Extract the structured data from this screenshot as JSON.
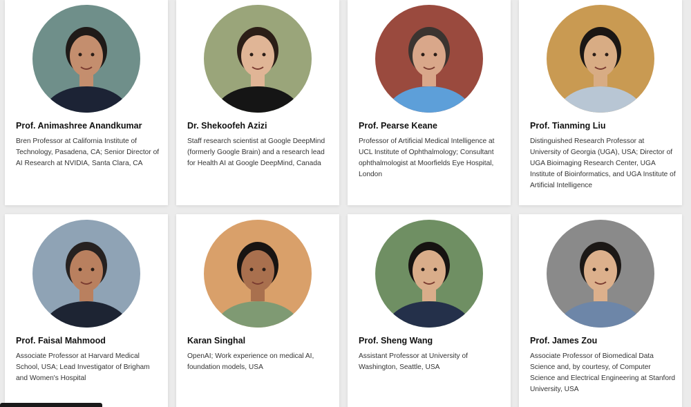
{
  "people": [
    {
      "name": "Prof. Animashree Anandkumar",
      "description": "Bren Professor at California Institute of Technology, Pasadena, CA; Senior Director of AI Research at NVIDIA, Santa Clara, CA",
      "photo": "portrait-photo",
      "bg": "#6f8f8a",
      "skin": "#c48e6e",
      "hair": "#1f1a18",
      "shirt": "#1c2335"
    },
    {
      "name": "Dr. Shekoofeh Azizi",
      "description": "Staff research scientist at Google DeepMind (formerly Google Brain) and a research lead for Health AI at Google DeepMind, Canada",
      "photo": "portrait-photo",
      "bg": "#9aa57a",
      "skin": "#e0b596",
      "hair": "#2b1e17",
      "shirt": "#151515"
    },
    {
      "name": "Prof. Pearse Keane",
      "description": "Professor of Artificial Medical Intelligence at UCL Institute of Ophthalmology; Consultant ophthalmologist at Moorfields Eye Hospital, London",
      "photo": "portrait-photo",
      "bg": "#9a4a3e",
      "skin": "#d9a78a",
      "hair": "#3b3430",
      "shirt": "#5d9fd9"
    },
    {
      "name": "Prof. Tianming Liu",
      "description": "Distinguished Research Professor at University of Georgia (UGA), USA; Director of UGA Bioimaging Research Center, UGA Institute of Bioinformatics, and UGA Institute of Artificial Intelligence",
      "photo": "portrait-photo",
      "bg": "#c99a52",
      "skin": "#d8ac84",
      "hair": "#1a1614",
      "shirt": "#b8c6d4"
    },
    {
      "name": "Prof. Faisal Mahmood",
      "description": "Associate Professor at Harvard Medical School, USA; Lead Investigator of Brigham and Women's Hospital",
      "photo": "portrait-photo",
      "bg": "#8fa3b5",
      "skin": "#b9805f",
      "hair": "#262120",
      "shirt": "#1d2433"
    },
    {
      "name": "Karan Singhal",
      "description": "OpenAI; Work experience on medical AI, foundation models, USA",
      "photo": "portrait-photo",
      "bg": "#d9a06a",
      "skin": "#a9704e",
      "hair": "#181412",
      "shirt": "#7f9a73"
    },
    {
      "name": "Prof. Sheng Wang",
      "description": "Assistant Professor at University of Washington, Seattle, USA",
      "photo": "portrait-photo",
      "bg": "#6f8f63",
      "skin": "#d9ad8a",
      "hair": "#161311",
      "shirt": "#24304a"
    },
    {
      "name": "Prof. James Zou",
      "description": "Associate Professor of Biomedical Data Science and, by courtesy, of Computer Science and Electrical Engineering at Stanford University, USA",
      "photo": "portrait-photo",
      "bg": "#8a8a8a",
      "skin": "#dcb08c",
      "hair": "#1c1816",
      "shirt": "#6d86a8"
    }
  ]
}
